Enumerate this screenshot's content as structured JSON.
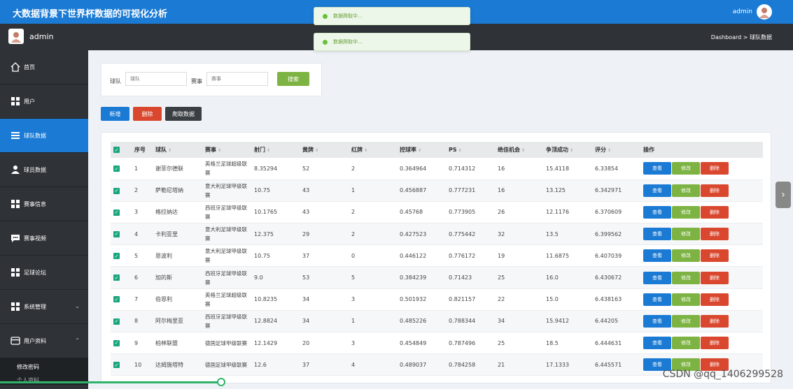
{
  "app": {
    "title": "大数据背景下世界杯数据的可视化分析"
  },
  "header": {
    "username": "admin"
  },
  "subbar": {
    "username": "admin",
    "breadcrumb": "Dashboard > 球队数据"
  },
  "toasts": [
    "数据爬取中...",
    "数据爬取中..."
  ],
  "sidebar": {
    "items": [
      {
        "label": "首页",
        "icon": "home-icon"
      },
      {
        "label": "用户",
        "icon": "grid-icon"
      },
      {
        "label": "球队数据",
        "icon": "list-icon"
      },
      {
        "label": "球员数据",
        "icon": "user-icon"
      },
      {
        "label": "赛事信息",
        "icon": "grid-icon"
      },
      {
        "label": "赛事视频",
        "icon": "chat-icon"
      },
      {
        "label": "足球论坛",
        "icon": "grid-icon"
      },
      {
        "label": "系统管理",
        "icon": "grid-icon"
      },
      {
        "label": "用户资料",
        "icon": "card-icon"
      }
    ],
    "sub_items": [
      "修改密码",
      "个人资料"
    ]
  },
  "search": {
    "team_label": "球队",
    "team_placeholder": "球队",
    "event_label": "赛事",
    "event_placeholder": "赛事",
    "search_button": "搜索"
  },
  "actions": {
    "add": "新增",
    "delete": "删除",
    "crawl": "爬取数据"
  },
  "table": {
    "headers": [
      "序号",
      "球队",
      "赛事",
      "射门",
      "黄牌",
      "红牌",
      "控球率",
      "PS",
      "绝佳机会",
      "争顶成功",
      "评分",
      "操作"
    ],
    "rows": [
      [
        "1",
        "谢菲尔德联",
        "英格兰足球超级联赛",
        "8.35294",
        "52",
        "2",
        "0.364964",
        "0.714312",
        "16",
        "15.4118",
        "6.33854"
      ],
      [
        "2",
        "萨勒尼塔纳",
        "意大利足球甲级联赛",
        "10.75",
        "43",
        "1",
        "0.456887",
        "0.777231",
        "16",
        "13.125",
        "6.342971"
      ],
      [
        "3",
        "格拉纳达",
        "西班牙足球甲级联赛",
        "10.1765",
        "43",
        "2",
        "0.45768",
        "0.773905",
        "26",
        "12.1176",
        "6.370609"
      ],
      [
        "4",
        "卡利亚里",
        "意大利足球甲级联赛",
        "12.375",
        "29",
        "2",
        "0.427523",
        "0.775442",
        "32",
        "13.5",
        "6.399562"
      ],
      [
        "5",
        "恩波利",
        "意大利足球甲级联赛",
        "10.75",
        "37",
        "0",
        "0.446122",
        "0.776172",
        "19",
        "11.6875",
        "6.407039"
      ],
      [
        "6",
        "加的斯",
        "西班牙足球甲级联赛",
        "9.0",
        "53",
        "5",
        "0.384239",
        "0.71423",
        "25",
        "16.0",
        "6.430672"
      ],
      [
        "7",
        "伯恩利",
        "英格兰足球超级联赛",
        "10.8235",
        "34",
        "3",
        "0.501932",
        "0.821157",
        "22",
        "15.0",
        "6.438163"
      ],
      [
        "8",
        "阿尔梅里亚",
        "西班牙足球甲级联赛",
        "12.8824",
        "34",
        "1",
        "0.485226",
        "0.788344",
        "34",
        "15.9412",
        "6.44205"
      ],
      [
        "9",
        "柏林联盟",
        "德国足球甲级联赛",
        "12.1429",
        "20",
        "3",
        "0.454849",
        "0.787496",
        "25",
        "18.5",
        "6.444631"
      ],
      [
        "10",
        "达姆施塔特",
        "德国足球甲级联赛",
        "12.6",
        "37",
        "4",
        "0.489037",
        "0.784258",
        "21",
        "17.1333",
        "6.445571"
      ]
    ],
    "row_actions": {
      "view": "查看",
      "edit": "修改",
      "delete": "删除"
    }
  },
  "video_progress": 0.28,
  "watermark": "CSDN @qq_1406299528"
}
